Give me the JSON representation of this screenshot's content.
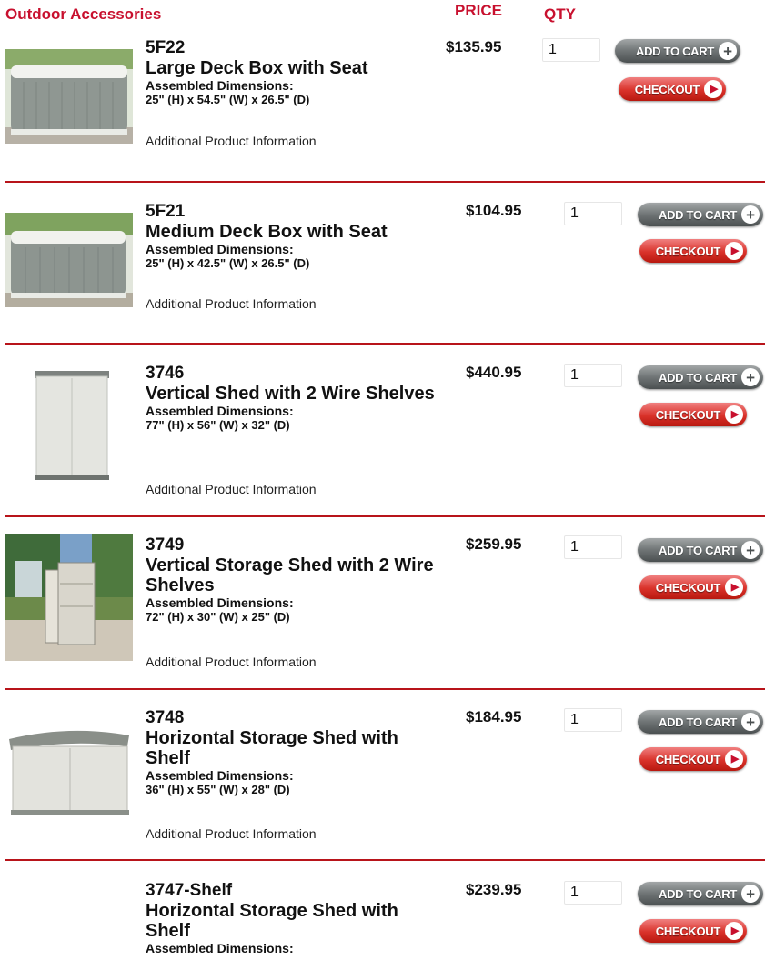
{
  "header": {
    "title": "Outdoor Accessories",
    "price_label": "PRICE",
    "qty_label": "QTY"
  },
  "buttons": {
    "add_to_cart": "ADD TO CART",
    "checkout": "CHECKOUT"
  },
  "icons": {
    "add": "plus-circle-icon",
    "checkout": "play-arrow-circle-icon"
  },
  "colors": {
    "accent": "#c8102e",
    "divider": "#b8141a",
    "add_button": "#5f6465",
    "checkout_button": "#d22a22"
  },
  "products": [
    {
      "code": "5F22",
      "name": "Large Deck Box with Seat",
      "dims_label": "Assembled Dimensions:",
      "dims": "25\" (H) x 54.5\" (W) x 26.5\" (D)",
      "info_link": "Additional Product Information",
      "price": "$135.95",
      "qty": "1"
    },
    {
      "code": "5F21",
      "name": "Medium Deck Box with Seat",
      "dims_label": "Assembled Dimensions:",
      "dims": "25\" (H) x 42.5\" (W) x 26.5\" (D)",
      "info_link": "Additional Product Information",
      "price": "$104.95",
      "qty": "1"
    },
    {
      "code": "3746",
      "name": "Vertical Shed with 2 Wire Shelves",
      "dims_label": "Assembled Dimensions:",
      "dims": "77\" (H) x 56\" (W) x 32\" (D)",
      "info_link": "Additional Product Information",
      "price": "$440.95",
      "qty": "1"
    },
    {
      "code": "3749",
      "name": "Vertical Storage Shed with 2 Wire Shelves",
      "dims_label": "Assembled Dimensions:",
      "dims": "72\" (H) x 30\" (W) x 25\" (D)",
      "info_link": "Additional Product Information",
      "price": "$259.95",
      "qty": "1"
    },
    {
      "code": "3748",
      "name": "Horizontal Storage Shed with Shelf",
      "dims_label": "Assembled Dimensions:",
      "dims": "36\" (H) x 55\" (W) x 28\" (D)",
      "info_link": "Additional Product Information",
      "price": "$184.95",
      "qty": "1"
    },
    {
      "code": "3747-Shelf",
      "name": "Horizontal Storage Shed with Shelf",
      "dims_label": "Assembled Dimensions:",
      "price": "$239.95",
      "qty": "1"
    }
  ]
}
